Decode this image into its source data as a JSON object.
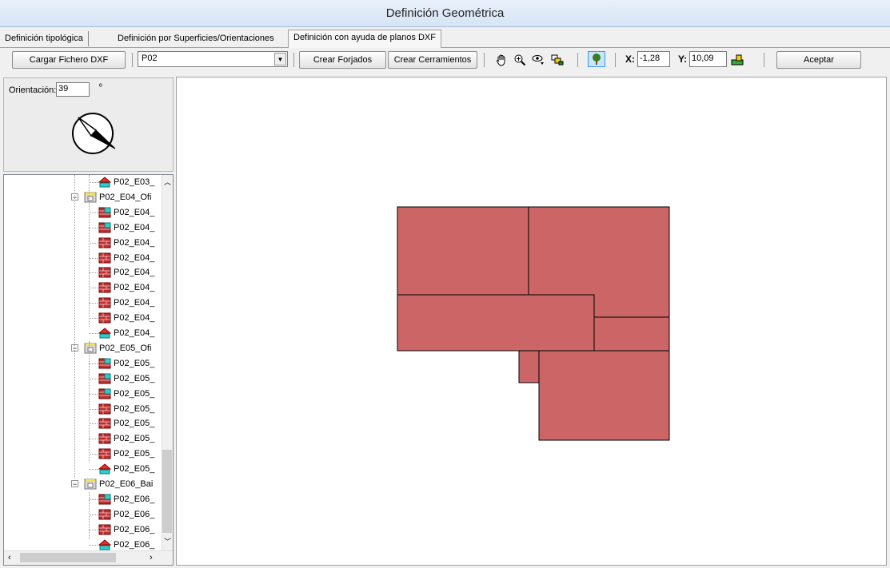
{
  "window": {
    "title": "Definición Geométrica"
  },
  "tabs": [
    {
      "label": "Definición tipológica"
    },
    {
      "label": "Definición por Superficies/Orientaciones"
    },
    {
      "label": "Definición con ayuda de planos DXF"
    }
  ],
  "toolbar": {
    "load_dxf_label": "Cargar Fichero DXF",
    "floor_selected": "P02",
    "create_slabs_label": "Crear Forjados",
    "create_walls_label": "Crear Cerramientos",
    "x_label": "X:",
    "x_value": "-1,28",
    "y_label": "Y:",
    "y_value": "10,09",
    "accept_label": "Aceptar"
  },
  "orientation": {
    "label": "Orientación:",
    "value": "39",
    "unit": "º"
  },
  "tree": {
    "items": [
      {
        "label": "P02_E03_",
        "icon": "roof-icon",
        "level": 2
      },
      {
        "label": "P02_E04_Ofi",
        "icon": "space-folder-icon",
        "level": 1
      },
      {
        "label": "P02_E04_",
        "icon": "window-wall-icon",
        "level": 2
      },
      {
        "label": "P02_E04_",
        "icon": "window-wall-icon",
        "level": 2
      },
      {
        "label": "P02_E04_",
        "icon": "brick-wall-icon",
        "level": 2
      },
      {
        "label": "P02_E04_",
        "icon": "brick-wall-icon",
        "level": 2
      },
      {
        "label": "P02_E04_",
        "icon": "brick-wall-icon",
        "level": 2
      },
      {
        "label": "P02_E04_",
        "icon": "brick-wall-icon",
        "level": 2
      },
      {
        "label": "P02_E04_",
        "icon": "brick-wall-icon",
        "level": 2
      },
      {
        "label": "P02_E04_",
        "icon": "brick-wall-icon",
        "level": 2
      },
      {
        "label": "P02_E04_",
        "icon": "roof-icon",
        "level": 2
      },
      {
        "label": "P02_E05_Ofi",
        "icon": "space-folder-icon",
        "level": 1
      },
      {
        "label": "P02_E05_",
        "icon": "window-wall-icon",
        "level": 2
      },
      {
        "label": "P02_E05_",
        "icon": "window-wall-icon",
        "level": 2
      },
      {
        "label": "P02_E05_",
        "icon": "window-wall-icon",
        "level": 2
      },
      {
        "label": "P02_E05_",
        "icon": "brick-wall-icon",
        "level": 2
      },
      {
        "label": "P02_E05_",
        "icon": "brick-wall-icon",
        "level": 2
      },
      {
        "label": "P02_E05_",
        "icon": "brick-wall-icon",
        "level": 2
      },
      {
        "label": "P02_E05_",
        "icon": "brick-wall-icon",
        "level": 2
      },
      {
        "label": "P02_E05_",
        "icon": "roof-icon",
        "level": 2
      },
      {
        "label": "P02_E06_Bai",
        "icon": "space-folder-icon",
        "level": 1
      },
      {
        "label": "P02_E06_",
        "icon": "window-wall-icon",
        "level": 2
      },
      {
        "label": "P02_E06_",
        "icon": "brick-wall-icon",
        "level": 2
      },
      {
        "label": "P02_E06_",
        "icon": "brick-wall-icon",
        "level": 2
      },
      {
        "label": "P02_E06_",
        "icon": "roof-icon",
        "level": 2
      }
    ]
  },
  "colors": {
    "space_fill": "#cc6666",
    "space_stroke": "#000000",
    "accent": "#3399ff"
  }
}
